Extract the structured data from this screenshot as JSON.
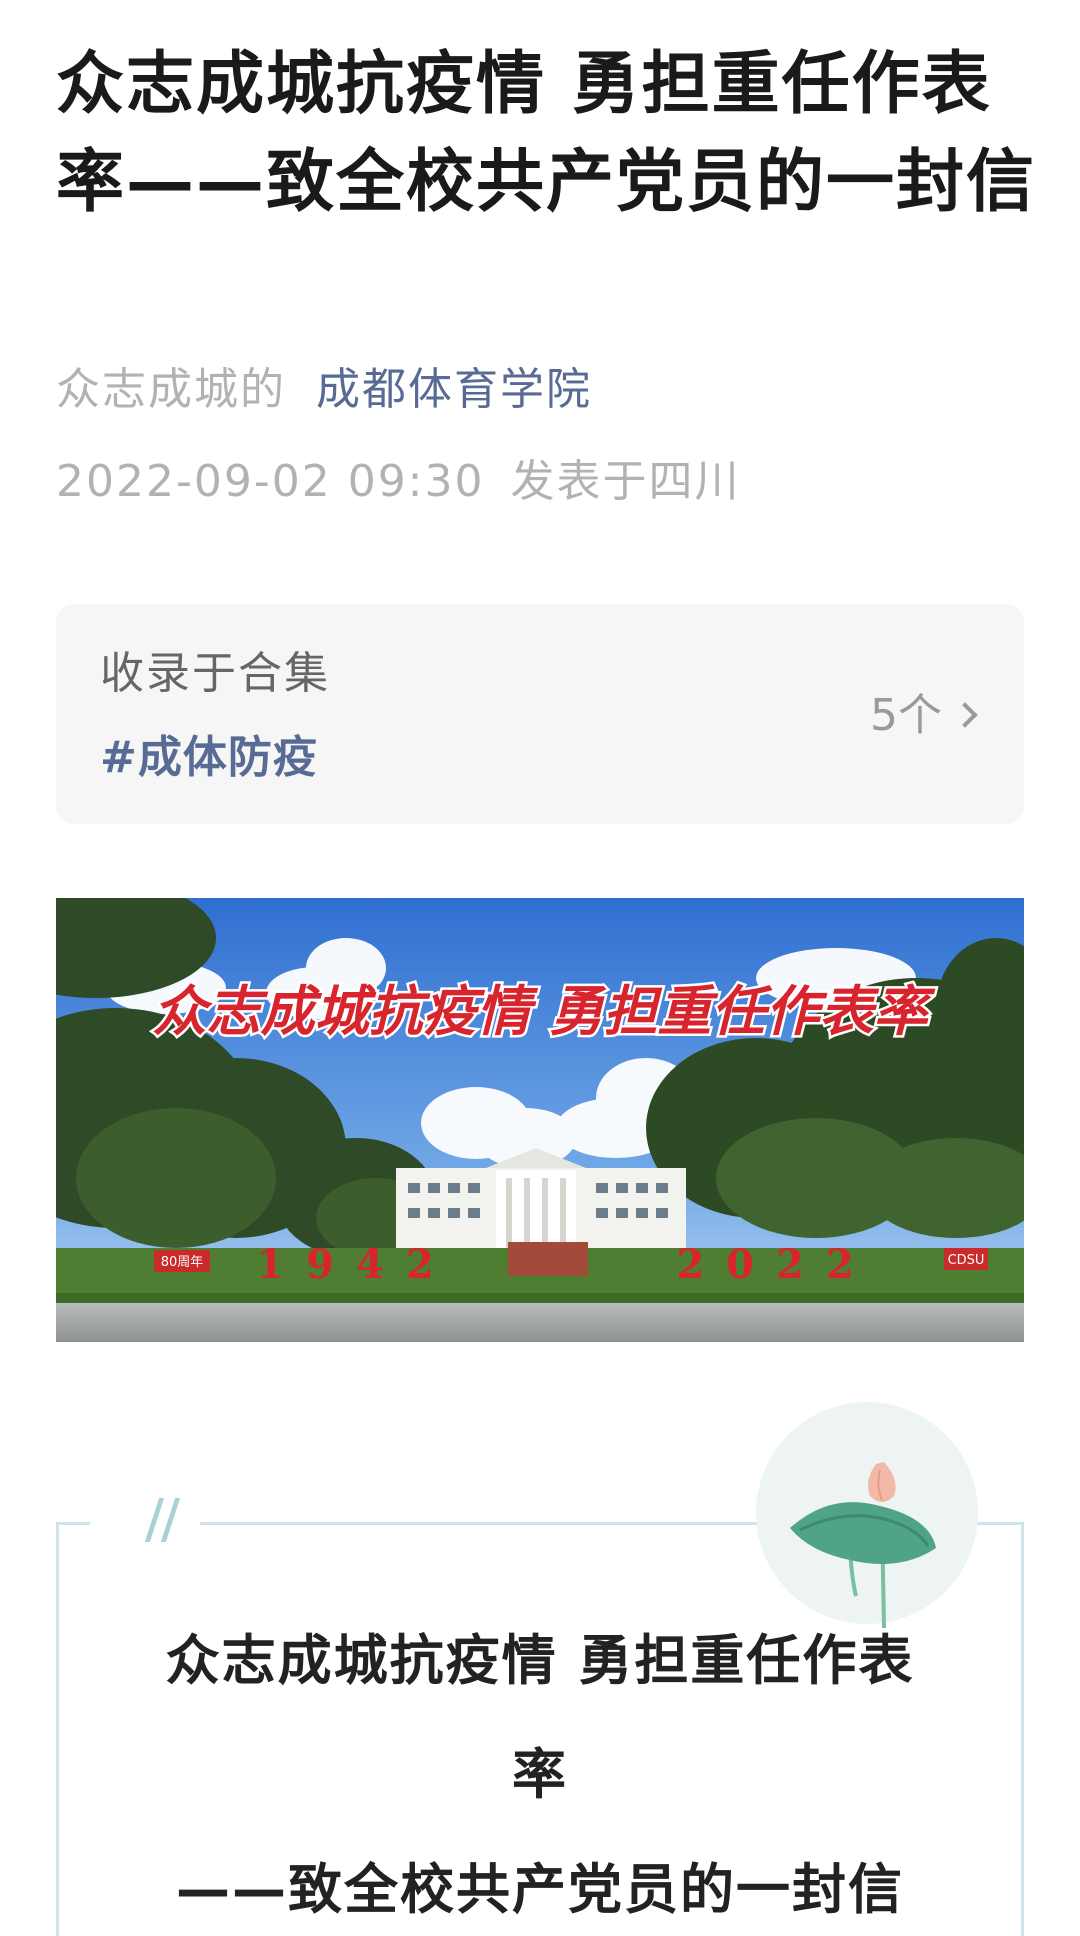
{
  "article": {
    "title": "众志成城抗疫情 勇担重任作表率——致全校共产党员的一封信",
    "author": "众志成城的",
    "account": "成都体育学院",
    "date": "2022-09-02 09:30",
    "location": "发表于四川"
  },
  "collection": {
    "label": "收录于合集",
    "tag": "#成体防疫",
    "count": "5个"
  },
  "banner": {
    "slogan": "众志成城抗疫情 勇担重任作表率",
    "year_start": "1942",
    "year_end": "2022",
    "sign_left": "80周年",
    "sign_right": "CDSU"
  },
  "letter": {
    "title_line1": "众志成城抗疫情 勇担重任作表",
    "title_line2": "率",
    "title_line3": "——致全校共产党员的一封信"
  },
  "colors": {
    "link_blue": "#576b95",
    "meta_gray": "#b2b2b2",
    "card_bg": "#f6f6f6",
    "slogan_red": "#d8242c"
  }
}
